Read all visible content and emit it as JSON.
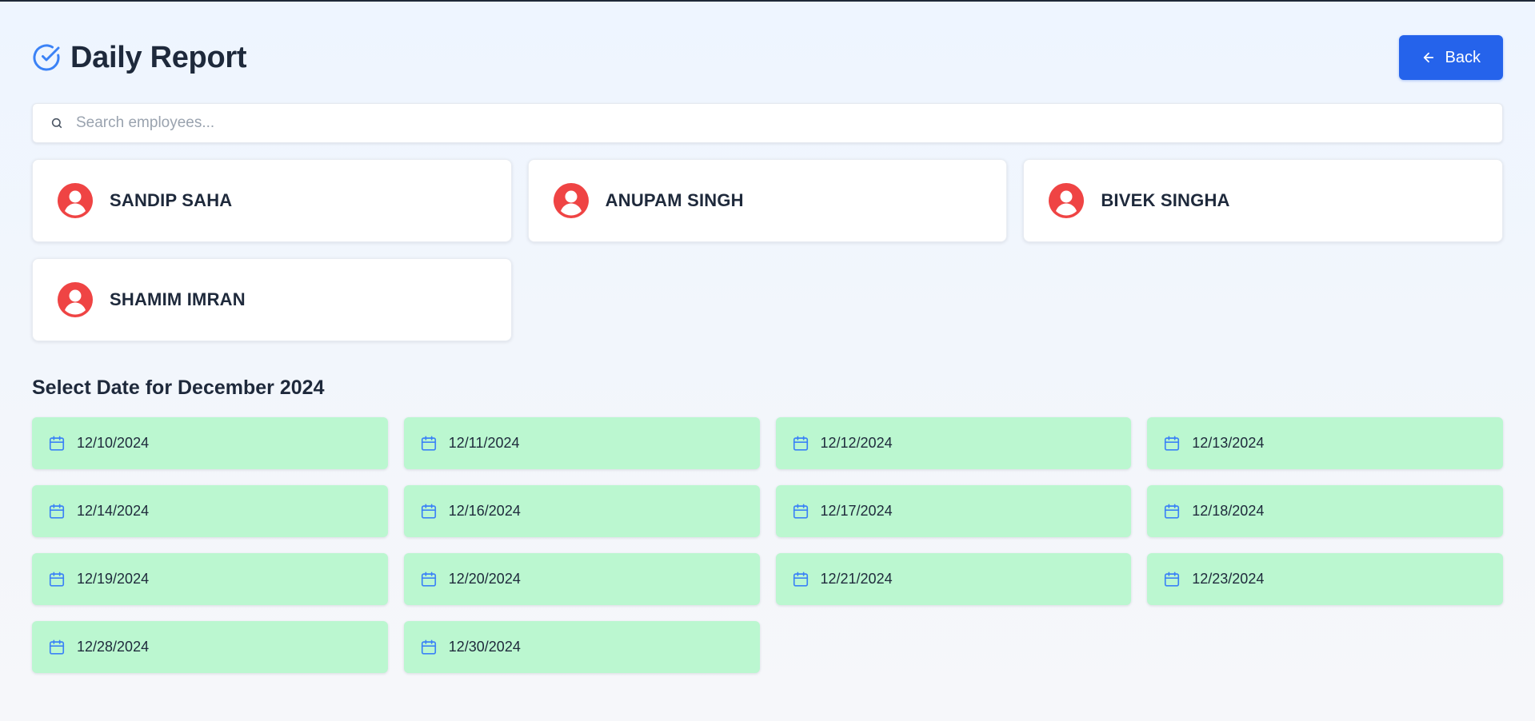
{
  "header": {
    "title": "Daily Report",
    "title_icon": "check-circle-icon",
    "back_label": "Back",
    "back_icon": "arrow-left-icon"
  },
  "search": {
    "placeholder": "Search employees...",
    "value": "",
    "icon": "search-icon"
  },
  "employees": [
    {
      "name": "SANDIP SAHA",
      "icon": "user-circle-icon"
    },
    {
      "name": "ANUPAM SINGH",
      "icon": "user-circle-icon"
    },
    {
      "name": "BIVEK SINGHA",
      "icon": "user-circle-icon"
    },
    {
      "name": "SHAMIM IMRAN",
      "icon": "user-circle-icon"
    }
  ],
  "date_section": {
    "title": "Select Date for December 2024",
    "icon": "calendar-icon",
    "dates": [
      "12/10/2024",
      "12/11/2024",
      "12/12/2024",
      "12/13/2024",
      "12/14/2024",
      "12/16/2024",
      "12/17/2024",
      "12/18/2024",
      "12/19/2024",
      "12/20/2024",
      "12/21/2024",
      "12/23/2024",
      "12/28/2024",
      "12/30/2024"
    ]
  },
  "colors": {
    "primary": "#2563eb",
    "avatar": "#ef4444",
    "date_background": "#bbf7d0",
    "calendar_icon": "#3b82f6",
    "text": "#1e293b"
  }
}
